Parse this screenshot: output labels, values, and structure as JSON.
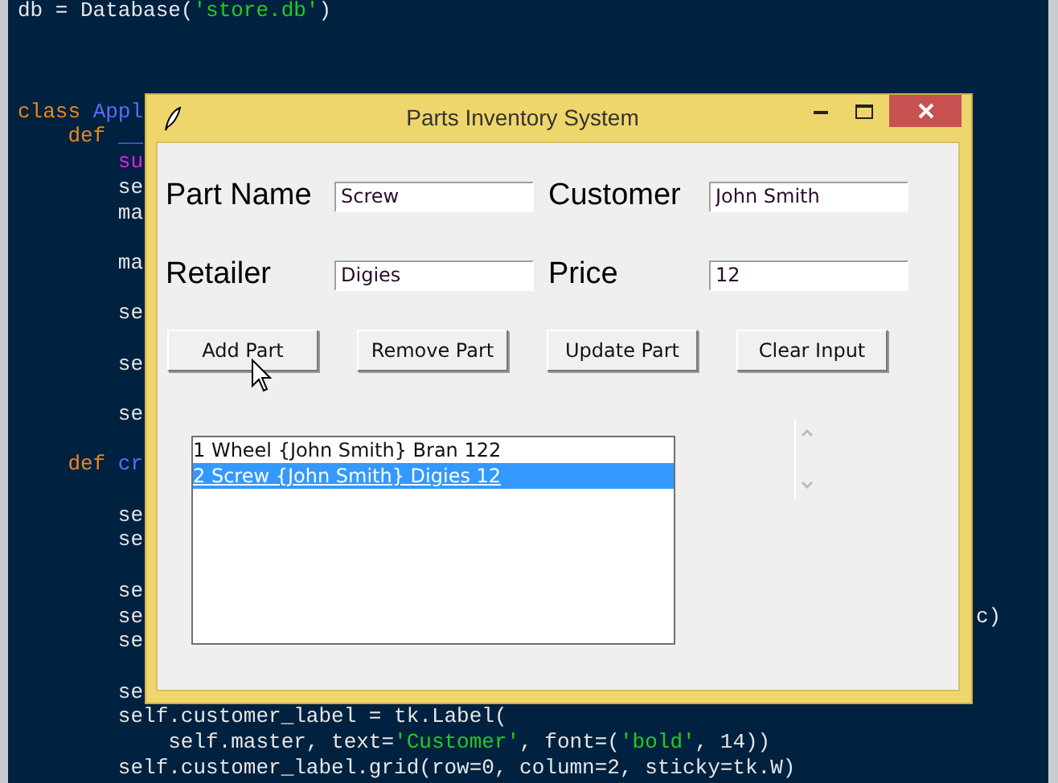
{
  "editor": {
    "lines": [
      {
        "kind": "code",
        "tokens": [
          {
            "text": "db = Database(",
            "kind": "plain"
          },
          {
            "text": "'store.db'",
            "kind": "string"
          },
          {
            "text": ")",
            "kind": "plain"
          }
        ]
      },
      {
        "kind": "blank"
      },
      {
        "kind": "blank"
      },
      {
        "kind": "blank"
      },
      {
        "kind": "code",
        "tokens": [
          {
            "text": "class ",
            "kind": "keyword"
          },
          {
            "text": "Appl",
            "kind": "name"
          }
        ]
      },
      {
        "kind": "code",
        "tokens": [
          {
            "text": "    def ",
            "kind": "keyword"
          },
          {
            "text": "__",
            "kind": "name"
          }
        ]
      },
      {
        "kind": "code",
        "tokens": [
          {
            "text": "        su",
            "kind": "builtin"
          }
        ]
      },
      {
        "kind": "code",
        "tokens": [
          {
            "text": "        se",
            "kind": "plain"
          }
        ]
      },
      {
        "kind": "code",
        "tokens": [
          {
            "text": "        ma",
            "kind": "plain"
          }
        ]
      },
      {
        "kind": "blank"
      },
      {
        "kind": "code",
        "tokens": [
          {
            "text": "        ma",
            "kind": "plain"
          }
        ]
      },
      {
        "kind": "blank"
      },
      {
        "kind": "code",
        "tokens": [
          {
            "text": "        se",
            "kind": "plain"
          }
        ]
      },
      {
        "kind": "blank"
      },
      {
        "kind": "code",
        "tokens": [
          {
            "text": "        se",
            "kind": "plain"
          }
        ]
      },
      {
        "kind": "blank"
      },
      {
        "kind": "code",
        "tokens": [
          {
            "text": "        se",
            "kind": "plain"
          }
        ]
      },
      {
        "kind": "blank"
      },
      {
        "kind": "code",
        "tokens": [
          {
            "text": "    def ",
            "kind": "keyword"
          },
          {
            "text": "cr",
            "kind": "name"
          }
        ]
      },
      {
        "kind": "blank"
      },
      {
        "kind": "code",
        "tokens": [
          {
            "text": "        se",
            "kind": "plain"
          }
        ]
      },
      {
        "kind": "code",
        "tokens": [
          {
            "text": "        se",
            "kind": "plain"
          }
        ]
      },
      {
        "kind": "blank"
      },
      {
        "kind": "code",
        "tokens": [
          {
            "text": "        se",
            "kind": "plain"
          }
        ]
      },
      {
        "kind": "code",
        "tokens": [
          {
            "text": "        se",
            "kind": "plain"
          }
        ],
        "tail": "c)"
      },
      {
        "kind": "code",
        "tokens": [
          {
            "text": "        se",
            "kind": "plain"
          }
        ]
      },
      {
        "kind": "blank"
      },
      {
        "kind": "code",
        "tokens": [
          {
            "text": "        se",
            "kind": "plain"
          }
        ]
      },
      {
        "kind": "code",
        "tokens": [
          {
            "text": "        self.customer_label = tk.Label(",
            "kind": "plain"
          }
        ]
      },
      {
        "kind": "code",
        "tokens": [
          {
            "text": "            self.master, text=",
            "kind": "plain"
          },
          {
            "text": "'Customer'",
            "kind": "string"
          },
          {
            "text": ", font=(",
            "kind": "plain"
          },
          {
            "text": "'bold'",
            "kind": "string"
          },
          {
            "text": ", 14))",
            "kind": "plain"
          }
        ]
      },
      {
        "kind": "code",
        "tokens": [
          {
            "text": "        self.customer_label.grid(row=0, column=2, sticky=tk.W)",
            "kind": "plain"
          }
        ]
      }
    ]
  },
  "window": {
    "title": "Parts Inventory System",
    "fields": [
      {
        "label": "Part Name",
        "value": "Screw"
      },
      {
        "label": "Customer",
        "value": "John Smith"
      },
      {
        "label": "Retailer",
        "value": "Digies"
      },
      {
        "label": "Price",
        "value": "12"
      }
    ],
    "buttons": [
      "Add Part",
      "Remove Part",
      "Update Part",
      "Clear Input"
    ],
    "list": {
      "items": [
        {
          "text": "1 Wheel {John Smith} Bran 122",
          "selected": false
        },
        {
          "text": "2 Screw {John Smith} Digies 12",
          "selected": true
        }
      ]
    }
  }
}
